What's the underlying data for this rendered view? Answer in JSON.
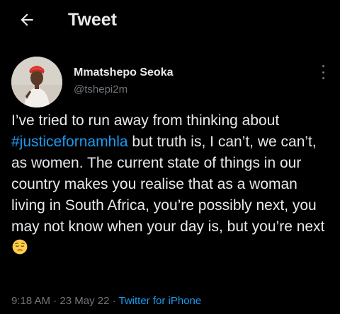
{
  "header": {
    "title": "Tweet",
    "back_icon": "arrow-left-icon"
  },
  "author": {
    "display_name": "Mmatshepo Seoka",
    "handle": "@tshepi2m",
    "avatar_icon": "avatar-photo",
    "more_icon": "vertical-ellipsis-icon"
  },
  "tweet": {
    "text_before_hashtag": "I’ve tried to run away from thinking about ",
    "hashtag": "#justicefornamhla",
    "text_after_hashtag": " but truth is, I can’t, we can’t, as women. The current state of things in our country makes you realise that as a woman living in South Africa, you’re possibly next, you may not know when your day is, but you’re next",
    "emoji": "pensive-face-emoji"
  },
  "meta": {
    "time": "9:18 AM",
    "separator_1": " · ",
    "date": "23 May 22",
    "separator_2": " · ",
    "source": "Twitter for iPhone"
  },
  "colors": {
    "background": "#000000",
    "text_primary": "#e7e9ea",
    "text_secondary": "#71767b",
    "link": "#1d9bf0"
  }
}
